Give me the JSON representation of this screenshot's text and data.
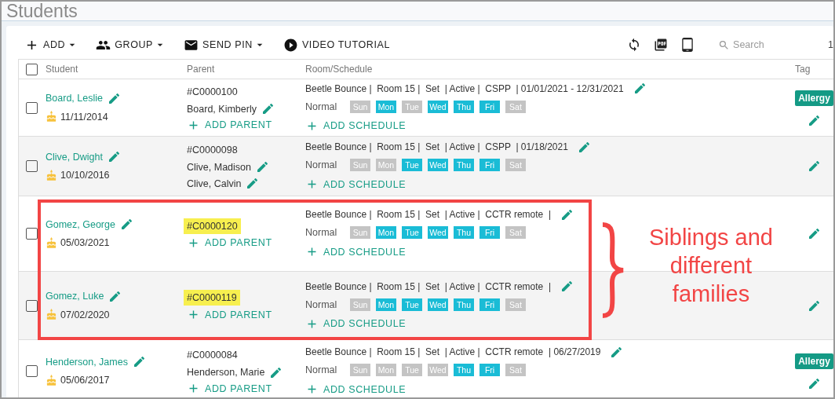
{
  "title": "Students",
  "toolbar": {
    "actions": [
      {
        "label": "ADD",
        "kind": "add",
        "dropdown": true
      },
      {
        "label": "GROUP",
        "kind": "group",
        "dropdown": true
      },
      {
        "label": "SEND PIN",
        "kind": "mail",
        "dropdown": true
      },
      {
        "label": "VIDEO TUTORIAL",
        "kind": "video",
        "dropdown": false
      }
    ],
    "search": {
      "placeholder": "Search"
    },
    "counter": "1"
  },
  "table": {
    "columns": [
      "Student",
      "Parent",
      "Room/Schedule",
      "Tag"
    ],
    "select_all_checked": false,
    "rows": [
      {
        "checked": false,
        "student": "Board, Leslie",
        "birthday": "11/11/2014",
        "parent_id": "#C0000100",
        "id_highlighted": false,
        "parents": [
          "Board, Kimberly"
        ],
        "add_parent": "ADD PARENT",
        "summary": "Beetle Bounce |  Room 15 |  Set  | Active |  CSPP  | 01/01/2021 - 12/31/2021",
        "plan": "Normal",
        "days": [
          {
            "label": "Sun",
            "on": false
          },
          {
            "label": "Mon",
            "on": true
          },
          {
            "label": "Tue",
            "on": false
          },
          {
            "label": "Wed",
            "on": true
          },
          {
            "label": "Thu",
            "on": true
          },
          {
            "label": "Fri",
            "on": true
          },
          {
            "label": "Sat",
            "on": false
          }
        ],
        "add_schedule": "ADD SCHEDULE",
        "tag": "Allergy"
      },
      {
        "checked": false,
        "student": "Clive, Dwight",
        "birthday": "10/10/2016",
        "parent_id": "#C0000098",
        "id_highlighted": false,
        "parents": [
          "Clive, Madison",
          "Clive, Calvin"
        ],
        "summary": "Beetle Bounce |  Room 15 |  Set  | Active |  CSPP  | 01/18/2021",
        "plan": "Normal",
        "days": [
          {
            "label": "Sun",
            "on": false
          },
          {
            "label": "Mon",
            "on": false
          },
          {
            "label": "Tue",
            "on": true
          },
          {
            "label": "Wed",
            "on": true
          },
          {
            "label": "Thu",
            "on": true
          },
          {
            "label": "Fri",
            "on": true
          },
          {
            "label": "Sat",
            "on": false
          }
        ],
        "add_schedule": "ADD SCHEDULE"
      },
      {
        "checked": false,
        "student": "Gomez, George",
        "birthday": "05/03/2021",
        "parent_id": "#C0000120",
        "id_highlighted": true,
        "parents": [],
        "add_parent": "ADD PARENT",
        "summary": "Beetle Bounce |  Room 15 |  Set  | Active |  CCTR remote  |",
        "plan": "Normal",
        "days": [
          {
            "label": "Sun",
            "on": false
          },
          {
            "label": "Mon",
            "on": true
          },
          {
            "label": "Tue",
            "on": true
          },
          {
            "label": "Wed",
            "on": true
          },
          {
            "label": "Thu",
            "on": true
          },
          {
            "label": "Fri",
            "on": true
          },
          {
            "label": "Sat",
            "on": false
          }
        ],
        "add_schedule": "ADD SCHEDULE"
      },
      {
        "checked": false,
        "student": "Gomez, Luke",
        "birthday": "07/02/2020",
        "parent_id": "#C0000119",
        "id_highlighted": true,
        "parents": [],
        "add_parent": "ADD PARENT",
        "summary": "Beetle Bounce |  Room 15 |  Set  | Active |  CCTR remote  |",
        "plan": "Normal",
        "days": [
          {
            "label": "Sun",
            "on": false
          },
          {
            "label": "Mon",
            "on": true
          },
          {
            "label": "Tue",
            "on": true
          },
          {
            "label": "Wed",
            "on": true
          },
          {
            "label": "Thu",
            "on": true
          },
          {
            "label": "Fri",
            "on": true
          },
          {
            "label": "Sat",
            "on": false
          }
        ],
        "add_schedule": "ADD SCHEDULE"
      },
      {
        "checked": false,
        "student": "Henderson, James",
        "birthday": "05/06/2017",
        "parent_id": "#C0000084",
        "id_highlighted": false,
        "parents": [
          "Henderson, Marie"
        ],
        "add_parent": "ADD PARENT",
        "summary": "Beetle Bounce |  Room 15 |  Set  | Active |  CCTR remote  | 06/27/2019",
        "plan": "Normal",
        "days": [
          {
            "label": "Sun",
            "on": false
          },
          {
            "label": "Mon",
            "on": false
          },
          {
            "label": "Tue",
            "on": false
          },
          {
            "label": "Wed",
            "on": false
          },
          {
            "label": "Thu",
            "on": true
          },
          {
            "label": "Fri",
            "on": true
          },
          {
            "label": "Sat",
            "on": false
          }
        ],
        "add_schedule": "ADD SCHEDULE",
        "tag": "Allergy"
      }
    ]
  },
  "annotation": {
    "text": "Siblings and different families"
  }
}
